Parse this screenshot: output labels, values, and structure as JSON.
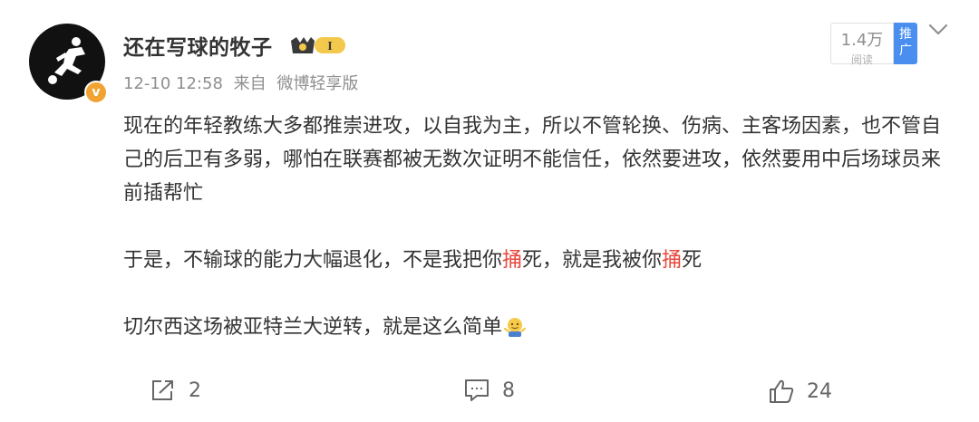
{
  "post": {
    "username": "还在写球的牧子",
    "vip_badge_label": "I",
    "verified_mark": "v",
    "timestamp": "12-10 12:58",
    "source_prefix": "来自",
    "source": "微博轻享版",
    "read_count": "1.4万",
    "read_label": "阅读",
    "promote_label_1": "推",
    "promote_label_2": "广",
    "content": {
      "para1": "现在的年轻教练大多都推崇进攻，以自我为主，所以不管轮换、伤病、主客场因素，也不管自己的后卫有多弱，哪怕在联赛都被无数次证明不能信任，依然要进攻，依然要用中后场球员来前插帮忙",
      "para2_a": "于是，不输球的能力大幅退化，不是我把你",
      "para2_hl1": "捅",
      "para2_b": "死，就是我被你",
      "para2_hl2": "捅",
      "para2_c": "死",
      "para3": "切尔西这场被亚特兰大逆转，就是这么简单"
    },
    "actions": {
      "share_count": "2",
      "comment_count": "8",
      "like_count": "24"
    }
  },
  "colors": {
    "highlight": "#e8473a",
    "promote_bg": "#4a8ff0",
    "verified": "#f0a332",
    "meta_text": "#8f8f8f"
  },
  "icons": {
    "avatar": "soccer-player-silhouette",
    "badge": "crown-vip-badge",
    "menu": "chevron-down-icon",
    "emoji": "shrug-emoji",
    "share": "share-icon",
    "comment": "comment-icon",
    "like": "thumbs-up-icon"
  }
}
